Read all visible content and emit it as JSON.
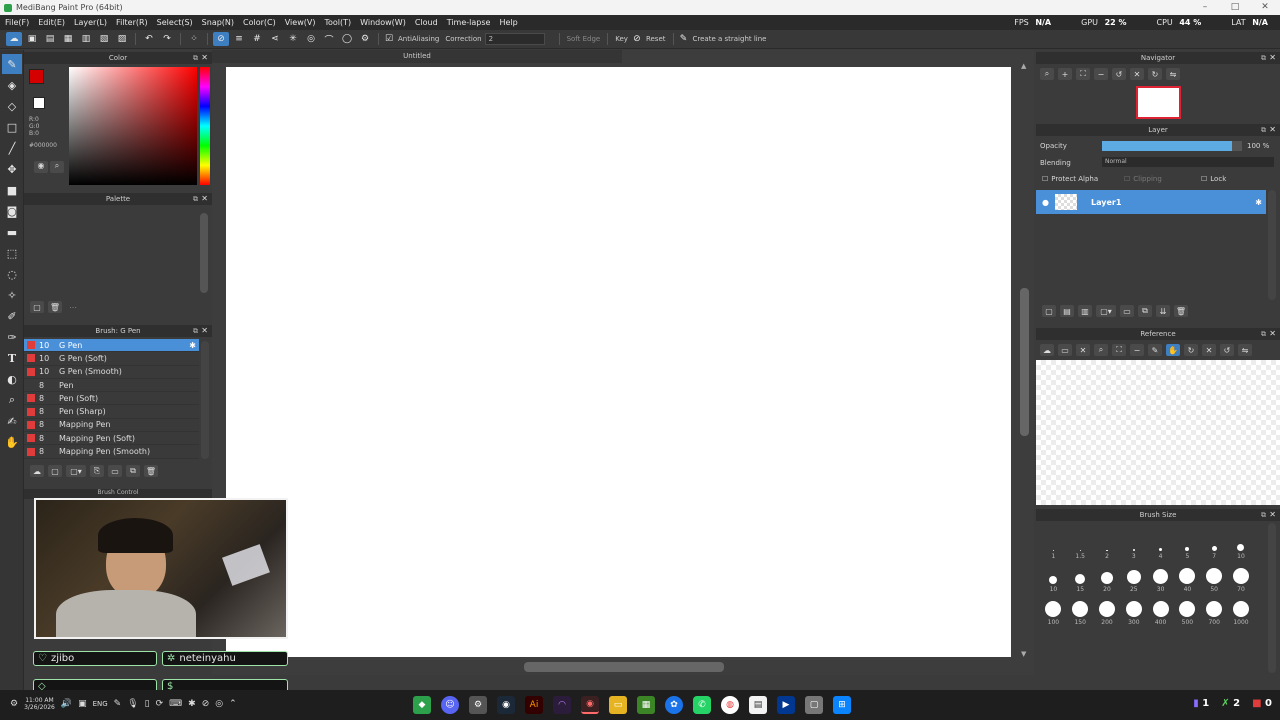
{
  "app": {
    "title": "MediBang Paint Pro (64bit)"
  },
  "menu": [
    "File(F)",
    "Edit(E)",
    "Layer(L)",
    "Filter(R)",
    "Select(S)",
    "Snap(N)",
    "Color(C)",
    "View(V)",
    "Tool(T)",
    "Window(W)",
    "Cloud",
    "Time-lapse",
    "Help"
  ],
  "stats": {
    "fps_label": "FPS",
    "fps": "N/A",
    "gpu_label": "GPU",
    "gpu": "22 %",
    "cpu_label": "CPU",
    "cpu": "44 %",
    "lat_label": "LAT",
    "lat": "N/A"
  },
  "toolbar": {
    "antialiasing": "AntiAliasing",
    "correction_label": "Correction",
    "correction_value": "2",
    "soft_edge": "Soft Edge",
    "key": "Key",
    "reset": "Reset",
    "straight_line": "Create a straight line"
  },
  "color_panel": {
    "title": "Color",
    "r": "R:0",
    "g": "G:0",
    "b": "B:0",
    "hex": "#000000",
    "primary": "#d40000",
    "secondary": "#ffffff"
  },
  "palette_panel": {
    "title": "Palette"
  },
  "brush_panel": {
    "title": "Brush: G Pen",
    "brushes": [
      {
        "size": "10",
        "name": "G Pen",
        "color": "#e03c3c"
      },
      {
        "size": "10",
        "name": "G Pen (Soft)",
        "color": "#e03c3c"
      },
      {
        "size": "10",
        "name": "G Pen (Smooth)",
        "color": "#e03c3c"
      },
      {
        "size": "8",
        "name": "Pen",
        "color": "#3a3a3a"
      },
      {
        "size": "8",
        "name": "Pen (Soft)",
        "color": "#e03c3c"
      },
      {
        "size": "8",
        "name": "Pen (Sharp)",
        "color": "#e03c3c"
      },
      {
        "size": "8",
        "name": "Mapping Pen",
        "color": "#e03c3c"
      },
      {
        "size": "8",
        "name": "Mapping Pen (Soft)",
        "color": "#e03c3c"
      },
      {
        "size": "8",
        "name": "Mapping Pen (Smooth)",
        "color": "#e03c3c"
      }
    ]
  },
  "brush_control": {
    "title": "Brush Control"
  },
  "canvas": {
    "tab_title": "Untitled"
  },
  "navigator": {
    "title": "Navigator"
  },
  "layer_panel": {
    "title": "Layer",
    "opacity_label": "Opacity",
    "opacity_value": "100 %",
    "opacity_fraction": 0.93,
    "blending_label": "Blending",
    "blending_value": "Normal",
    "protect_alpha": "Protect Alpha",
    "clipping": "Clipping",
    "lock": "Lock",
    "layers": [
      {
        "name": "Layer1"
      }
    ]
  },
  "reference_panel": {
    "title": "Reference"
  },
  "brush_size_panel": {
    "title": "Brush Size",
    "rows": [
      [
        "1",
        "1.5",
        "2",
        "3",
        "4",
        "5",
        "7",
        "10"
      ],
      [
        "10",
        "15",
        "20",
        "25",
        "30",
        "40",
        "50",
        "70"
      ],
      [
        "100",
        "150",
        "200",
        "300",
        "400",
        "500",
        "700",
        "1000"
      ]
    ]
  },
  "stream_overlay": {
    "user1": "zjibo",
    "user2": "neteinyahu",
    "field3": "",
    "field4": "$"
  },
  "taskbar": {
    "time": "11:00 AM",
    "date": "3/26/2026",
    "language": "ENG",
    "tray1": "1",
    "tray2": "2",
    "tray3": "0"
  }
}
